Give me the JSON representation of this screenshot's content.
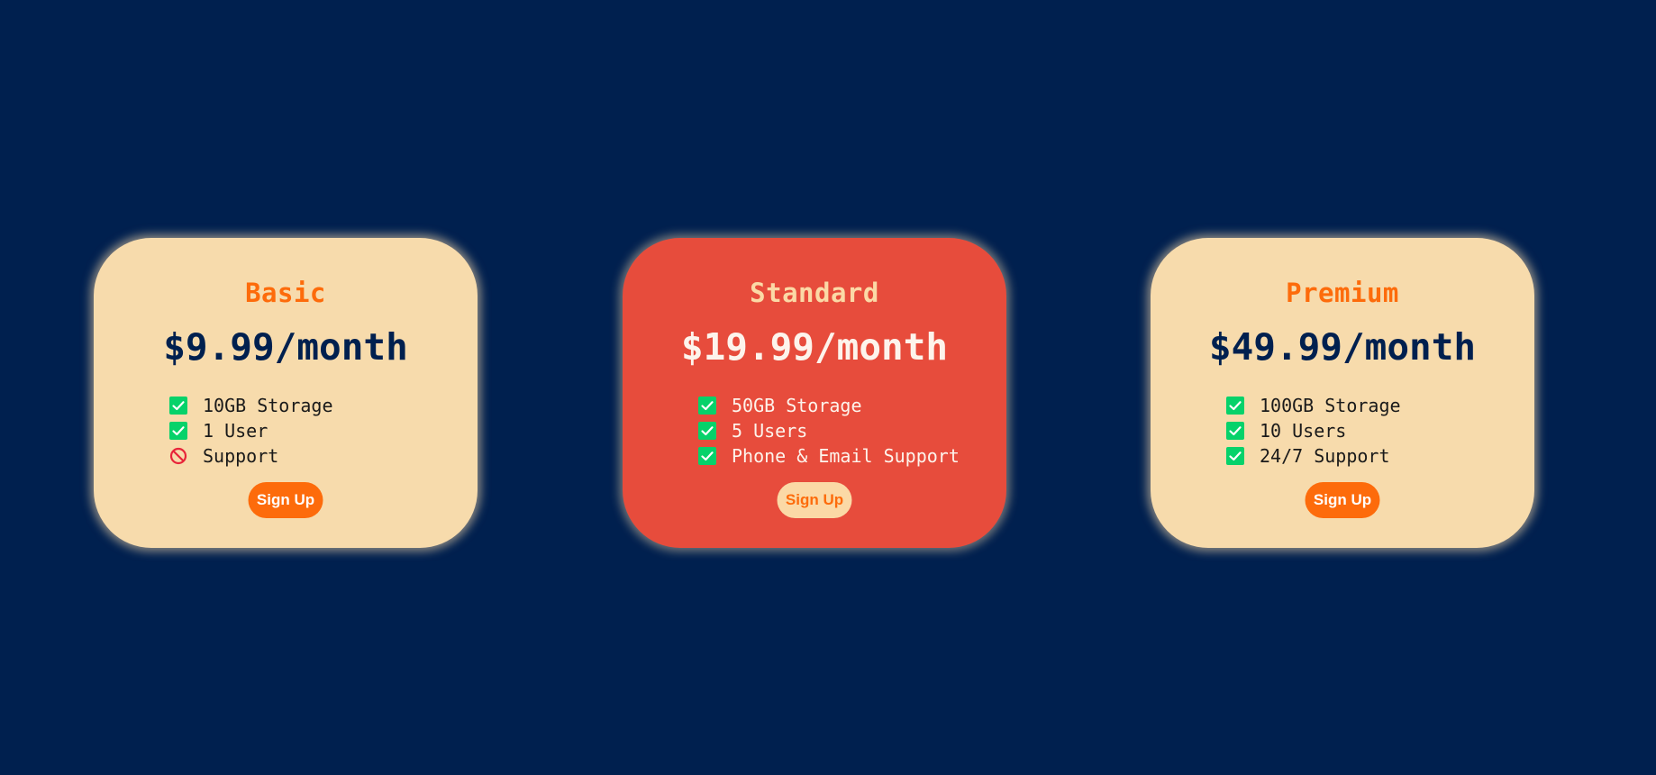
{
  "plans": [
    {
      "name": "Basic",
      "price": "$9.99/month",
      "features": [
        {
          "text": "10GB Storage",
          "icon": "check-icon"
        },
        {
          "text": "1 User",
          "icon": "check-icon"
        },
        {
          "text": "Support",
          "icon": "prohibited-icon"
        }
      ],
      "button_label": "Sign Up"
    },
    {
      "name": "Standard",
      "price": "$19.99/month",
      "features": [
        {
          "text": "50GB Storage",
          "icon": "check-icon"
        },
        {
          "text": "5 Users",
          "icon": "check-icon"
        },
        {
          "text": "Phone & Email Support",
          "icon": "check-icon"
        }
      ],
      "button_label": "Sign Up"
    },
    {
      "name": "Premium",
      "price": "$49.99/month",
      "features": [
        {
          "text": "100GB Storage",
          "icon": "check-icon"
        },
        {
          "text": "10 Users",
          "icon": "check-icon"
        },
        {
          "text": "24/7 Support",
          "icon": "check-icon"
        }
      ],
      "button_label": "Sign Up"
    }
  ],
  "colors": {
    "background": "#00204f",
    "card": "#f7dbac",
    "card_highlight": "#e74c3c",
    "accent": "#fd6b0b",
    "check": "#06d26a",
    "prohibited": "#e8253a"
  }
}
